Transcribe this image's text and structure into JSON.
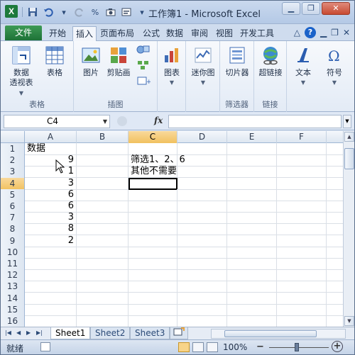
{
  "window": {
    "title": "工作簿1 - Microsoft Excel",
    "app_icon_letter": "X"
  },
  "ribbon_tabs": {
    "file": "文件",
    "items": [
      "开始",
      "插入",
      "页面布局",
      "公式",
      "数据",
      "审阅",
      "视图",
      "开发工具"
    ],
    "active": "插入"
  },
  "ribbon": {
    "groups": [
      {
        "label": "表格",
        "buttons": [
          "数据\n透视表",
          "表格"
        ]
      },
      {
        "label": "插图",
        "buttons": [
          "图片",
          "剪贴画"
        ]
      },
      {
        "label": "",
        "buttons": [
          "图表"
        ]
      },
      {
        "label": "",
        "buttons": [
          "迷你图"
        ]
      },
      {
        "label": "筛选器",
        "buttons": [
          "切片器"
        ]
      },
      {
        "label": "链接",
        "buttons": [
          "超链接"
        ]
      },
      {
        "label": "",
        "buttons": [
          "文本",
          "符号"
        ]
      }
    ],
    "pivot_label_1": "数据",
    "pivot_label_2": "透视表",
    "table_label": "表格",
    "picture_label": "图片",
    "clipart_label": "剪贴画",
    "chart_label": "图表",
    "sparkline_label": "迷你图",
    "slicer_label": "切片器",
    "hyperlink_label": "超链接",
    "text_label": "文本",
    "symbol_label": "符号",
    "group_tables": "表格",
    "group_illustrations": "插图",
    "group_filters": "筛选器",
    "group_links": "链接"
  },
  "formula_bar": {
    "name_box": "C4",
    "fx": "fx",
    "formula": ""
  },
  "grid": {
    "columns": [
      "A",
      "B",
      "C",
      "D",
      "E",
      "F"
    ],
    "selected_column": "C",
    "selected_row": "4",
    "rows": [
      {
        "n": "1",
        "A": "数据",
        "B": "",
        "C": ""
      },
      {
        "n": "2",
        "A": "9",
        "B": "",
        "C": "筛选1、2、6"
      },
      {
        "n": "3",
        "A": "1",
        "B": "",
        "C": "其他不需要"
      },
      {
        "n": "4",
        "A": "3",
        "B": "",
        "C": ""
      },
      {
        "n": "5",
        "A": "6",
        "B": "",
        "C": ""
      },
      {
        "n": "6",
        "A": "6",
        "B": "",
        "C": ""
      },
      {
        "n": "7",
        "A": "3",
        "B": "",
        "C": ""
      },
      {
        "n": "8",
        "A": "8",
        "B": "",
        "C": ""
      },
      {
        "n": "9",
        "A": "2",
        "B": "",
        "C": ""
      },
      {
        "n": "10",
        "A": "",
        "B": "",
        "C": ""
      },
      {
        "n": "11",
        "A": "",
        "B": "",
        "C": ""
      },
      {
        "n": "12",
        "A": "",
        "B": "",
        "C": ""
      },
      {
        "n": "13",
        "A": "",
        "B": "",
        "C": ""
      },
      {
        "n": "14",
        "A": "",
        "B": "",
        "C": ""
      },
      {
        "n": "15",
        "A": "",
        "B": "",
        "C": ""
      },
      {
        "n": "16",
        "A": "",
        "B": "",
        "C": ""
      }
    ]
  },
  "sheets": {
    "tabs": [
      "Sheet1",
      "Sheet2",
      "Sheet3"
    ],
    "active": "Sheet1"
  },
  "status": {
    "ready": "就绪",
    "zoom": "100%"
  }
}
